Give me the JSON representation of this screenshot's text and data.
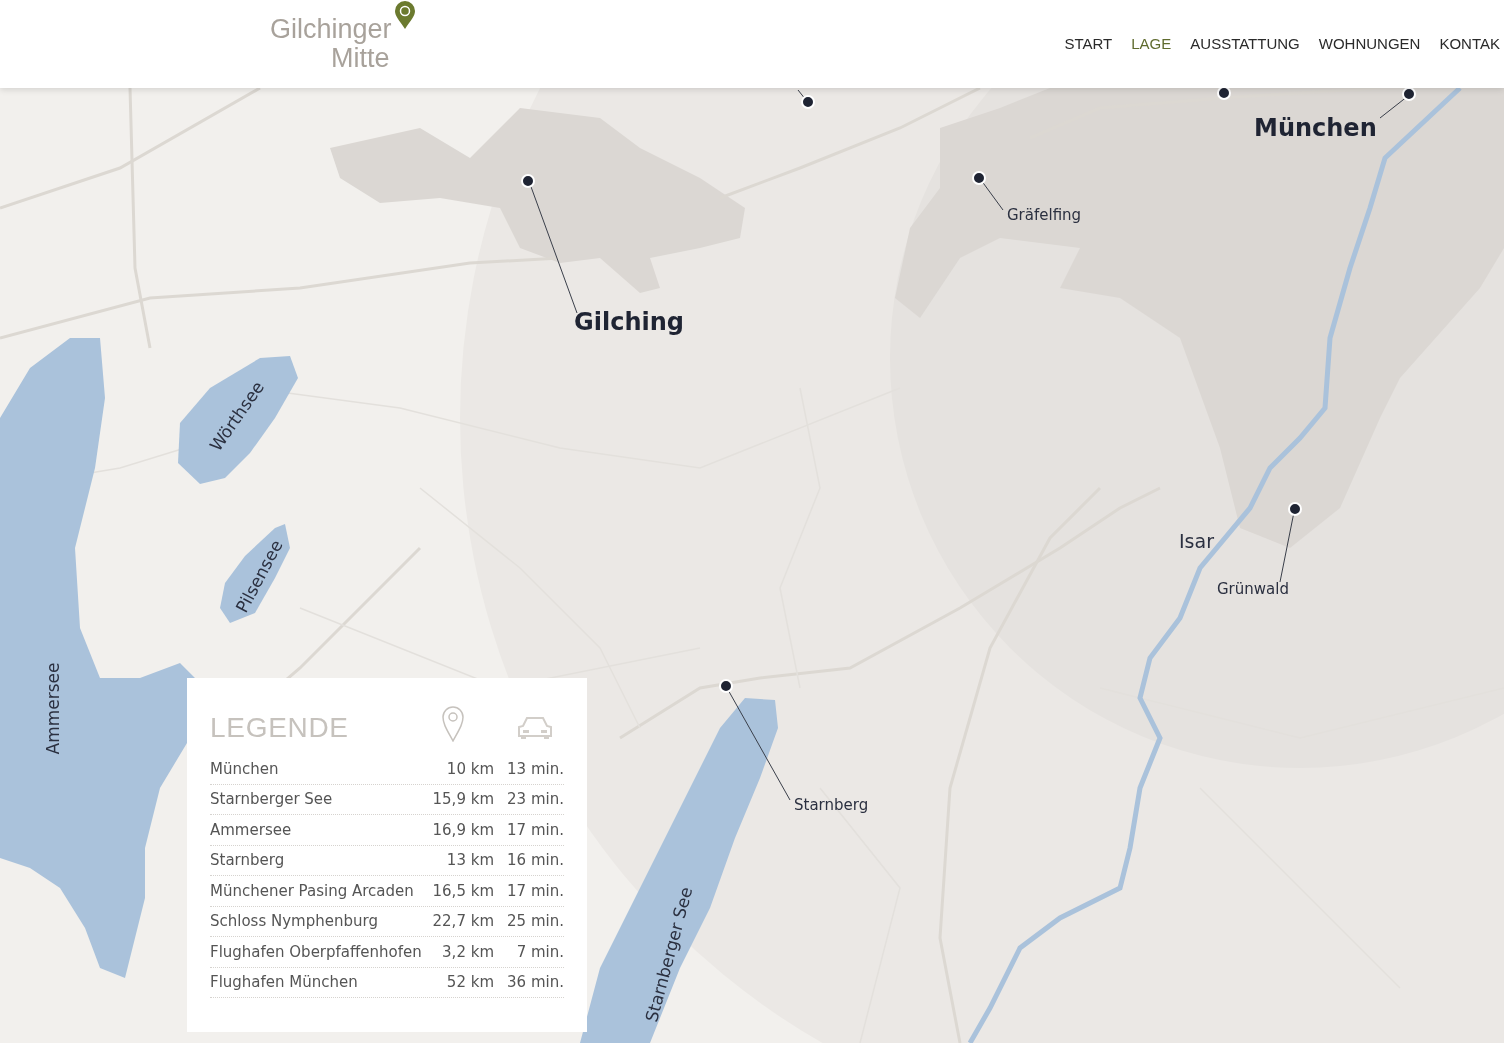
{
  "header": {
    "logo": {
      "line1": "Gilchinger",
      "line2": "Mitte"
    },
    "nav": [
      {
        "label": "START",
        "selected": false
      },
      {
        "label": "LAGE",
        "selected": true
      },
      {
        "label": "AUSSTATTUNG",
        "selected": false
      },
      {
        "label": "WOHNUNGEN",
        "selected": false
      },
      {
        "label": "KONTAK",
        "selected": false
      }
    ]
  },
  "map": {
    "labels": [
      {
        "text": "München",
        "kind": "city"
      },
      {
        "text": "Gräfelfing",
        "kind": "town"
      },
      {
        "text": "Gilching",
        "kind": "city"
      },
      {
        "text": "Wörthsee",
        "kind": "water"
      },
      {
        "text": "Isar",
        "kind": "river"
      },
      {
        "text": "Grünwald",
        "kind": "town"
      },
      {
        "text": "Pilsensee",
        "kind": "water"
      },
      {
        "text": "Ammersee",
        "kind": "water"
      },
      {
        "text": "Starnberg",
        "kind": "town"
      },
      {
        "text": "Starnberger See",
        "kind": "water"
      }
    ]
  },
  "legend": {
    "title": "LEGENDE",
    "rows": [
      {
        "place": "München",
        "distance": "10 km",
        "time": "13 min."
      },
      {
        "place": "Starnberger See",
        "distance": "15,9 km",
        "time": "23 min."
      },
      {
        "place": "Ammersee",
        "distance": "16,9 km",
        "time": "17 min."
      },
      {
        "place": "Starnberg",
        "distance": "13 km",
        "time": "16 min."
      },
      {
        "place": "Münchener Pasing Arcaden",
        "distance": "16,5 km",
        "time": "17 min."
      },
      {
        "place": "Schloss Nymphenburg",
        "distance": "22,7 km",
        "time": "25 min."
      },
      {
        "place": "Flughafen Oberpfaffenhofen",
        "distance": "3,2 km",
        "time": "7 min."
      },
      {
        "place": "Flughafen München",
        "distance": "52 km",
        "time": "36 min."
      }
    ]
  }
}
